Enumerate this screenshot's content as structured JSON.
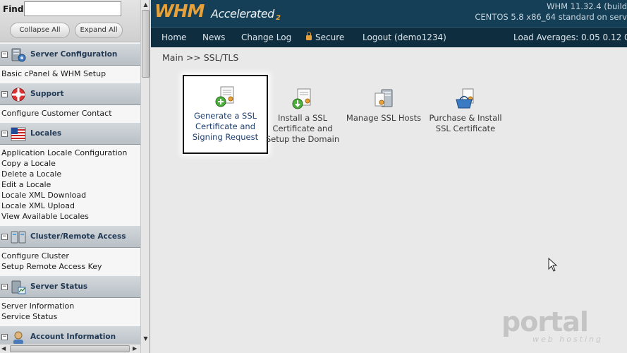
{
  "sidebar": {
    "find_label": "Find",
    "find_value": "",
    "collapse_all": "Collapse All",
    "expand_all": "Expand All",
    "groups": [
      {
        "title": "Server Configuration",
        "icon": "server-config-icon",
        "items": [
          "Basic cPanel & WHM Setup"
        ]
      },
      {
        "title": "Support",
        "icon": "lifebuoy-icon",
        "items": [
          "Configure Customer Contact"
        ]
      },
      {
        "title": "Locales",
        "icon": "flag-icon",
        "items": [
          "Application Locale Configuration",
          "Copy a Locale",
          "Delete a Locale",
          "Edit a Locale",
          "Locale XML Download",
          "Locale XML Upload",
          "View Available Locales"
        ]
      },
      {
        "title": "Cluster/Remote Access",
        "icon": "cluster-icon",
        "items": [
          "Configure Cluster",
          "Setup Remote Access Key"
        ]
      },
      {
        "title": "Server Status",
        "icon": "server-status-icon",
        "items": [
          "Server Information",
          "Service Status"
        ]
      },
      {
        "title": "Account Information",
        "icon": "account-icon",
        "items": []
      }
    ]
  },
  "header": {
    "logo_main": "WHM",
    "logo_sub": "Accelerated",
    "logo_num": "2",
    "version_line1": "WHM 11.32.4 (build",
    "version_line2": "CENTOS 5.8 x86_64 standard on serv"
  },
  "nav": {
    "home": "Home",
    "news": "News",
    "changelog": "Change Log",
    "secure": "Secure",
    "logout": "Logout (demo1234)",
    "load_avg": "Load Averages: 0.05 0.12 0"
  },
  "main": {
    "breadcrumb": "Main >> SSL/TLS",
    "tiles": [
      {
        "label": "Generate a SSL Certificate and Signing Request"
      },
      {
        "label": "Install a SSL Certificate and Setup the Domain"
      },
      {
        "label": "Manage SSL Hosts"
      },
      {
        "label": "Purchase & Install SSL Certificate"
      }
    ]
  },
  "watermark": {
    "text": "portal",
    "sub": "web hosting"
  },
  "colors": {
    "topbar": "#143f56",
    "nav": "#0e2d3f",
    "accent": "#e7a13a",
    "sidebar_header": "#c6ccd1"
  }
}
